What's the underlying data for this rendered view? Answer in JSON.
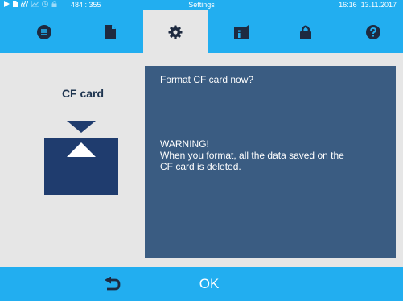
{
  "status_bar": {
    "icons": [
      "play-icon",
      "document-icon",
      "heater-icon",
      "chart-icon",
      "clock-icon",
      "lock-icon"
    ],
    "coordinates": "484 : 355",
    "title": "Settings",
    "time": "16:16",
    "date": "13.11.2017"
  },
  "tabs": [
    {
      "name": "menu",
      "icon": "list-icon",
      "active": false
    },
    {
      "name": "documents",
      "icon": "document-icon",
      "active": false
    },
    {
      "name": "settings",
      "icon": "gear-icon",
      "active": true
    },
    {
      "name": "info",
      "icon": "info-icon",
      "active": false
    },
    {
      "name": "security",
      "icon": "lock-icon",
      "active": false
    },
    {
      "name": "help",
      "icon": "help-icon",
      "active": false
    }
  ],
  "left_panel": {
    "title": "CF card",
    "icon": "cf-card-icon"
  },
  "dialog": {
    "question": "Format CF card now?",
    "warning_lines": [
      "WARNING!",
      "When you format, all the data saved on the",
      "CF card is deleted."
    ]
  },
  "bottom_bar": {
    "back_icon": "back-arrow-icon",
    "ok_label": "OK"
  },
  "colors": {
    "accent": "#22aef0",
    "dialog_bg": "#3a5c82",
    "card_icon": "#1f3c6e",
    "background": "#e6e6e6",
    "icon_dark": "#1e2a40"
  }
}
